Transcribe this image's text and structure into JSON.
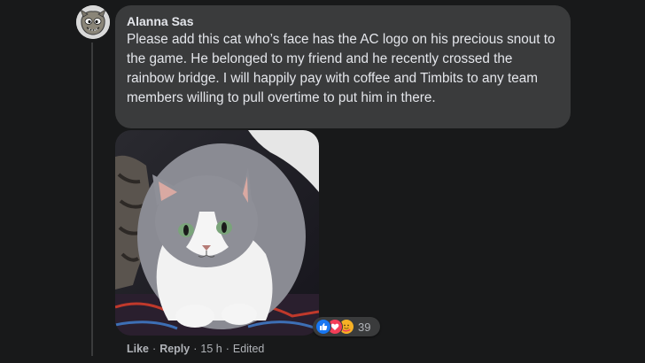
{
  "comment": {
    "author": "Alanna Sas",
    "text": "Please add this cat who’s face has the AC logo on his precious snout to the game. He belonged to my friend and he recently crossed the rainbow bridge. I will happily pay with coffee and Timbits to any team members willing to pull overtime to put him in there.",
    "reaction_icons": [
      "like-icon",
      "love-icon",
      "care-icon"
    ],
    "reaction_count": "39",
    "actions": {
      "like_label": "Like",
      "reply_label": "Reply",
      "time": "15 h",
      "edited": "Edited",
      "separator": "·"
    }
  },
  "colors": {
    "background": "#18191a",
    "bubble": "#3a3b3c",
    "text": "#e4e6eb",
    "secondary_text": "#b0b3b8",
    "like_blue": "#1877f2",
    "love_red": "#f33e58",
    "care_yellow": "#f7b125"
  }
}
